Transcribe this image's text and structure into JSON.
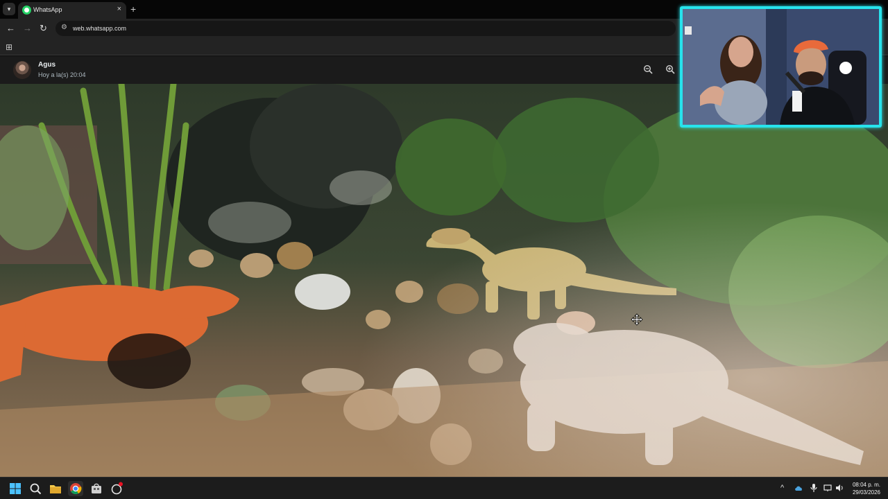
{
  "browser": {
    "tab_title": "WhatsApp",
    "tab_close": "×",
    "new_tab": "+",
    "url": "web.whatsapp.com",
    "back": "←",
    "forward": "→",
    "reload": "↻",
    "apps": "⊞"
  },
  "viewer": {
    "sender_name": "Agus",
    "sent_time": "Hoy a la(s) 20:04",
    "zoom_out_icon": "zoom-out-icon",
    "zoom_in_icon": "zoom-in-icon"
  },
  "taskbar": {
    "time": "08:04 p. m.",
    "date": "29/03/2026",
    "tray_chevron": "^",
    "apps": [
      "start-icon",
      "search-icon",
      "file-explorer-icon",
      "chrome-icon",
      "store-icon",
      "app-icon"
    ]
  },
  "colors": {
    "webcam_border": "#27e3ec",
    "whatsapp_green": "#25d366"
  }
}
